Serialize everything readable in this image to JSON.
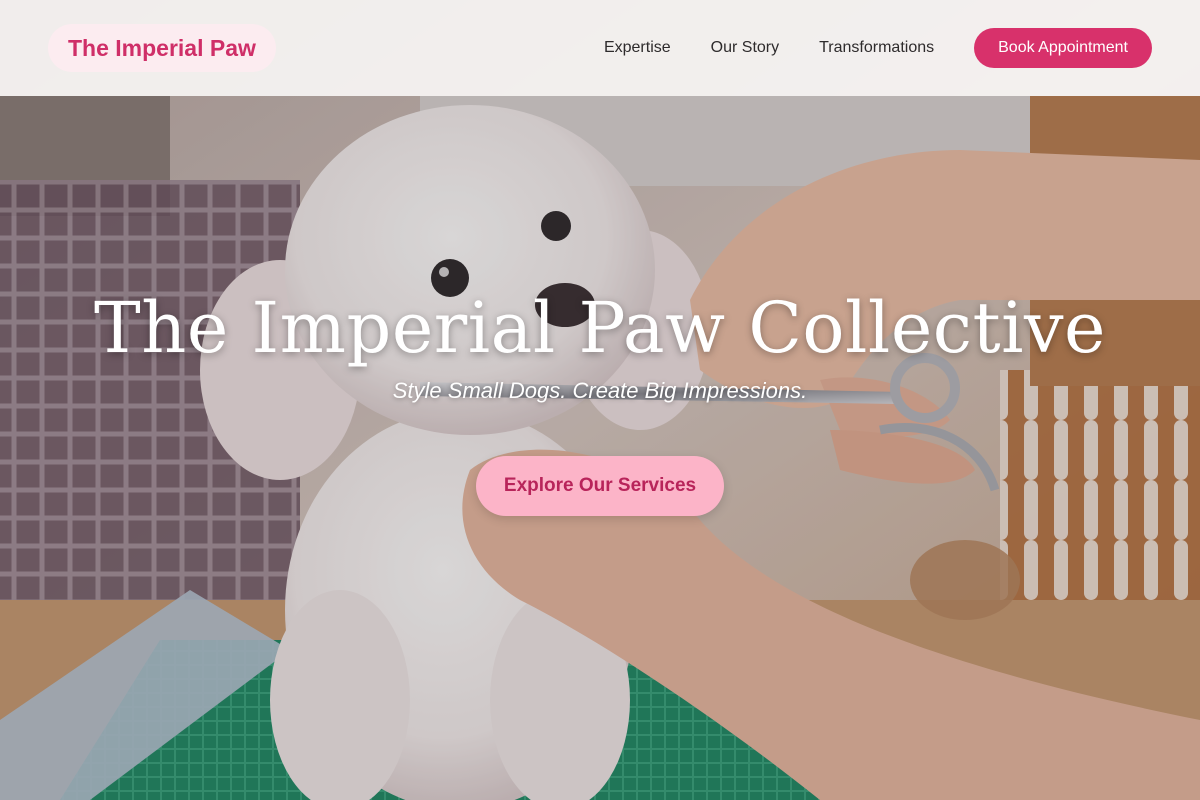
{
  "header": {
    "brand": "The Imperial Paw",
    "nav": [
      {
        "label": "Expertise"
      },
      {
        "label": "Our Story"
      },
      {
        "label": "Transformations"
      }
    ],
    "cta_label": "Book Appointment"
  },
  "hero": {
    "title": "The Imperial Paw Collective",
    "tagline": "Style Small Dogs. Create Big Impressions.",
    "cta_label": "Explore Our Services",
    "image": "white poodle being groomed with scissors on a green grooming table"
  },
  "colors": {
    "brand_pink": "#d8316b",
    "logo_text": "#cf2f68",
    "cta_background": "#fcb4c8",
    "cta_text": "#b8245a",
    "header_background": "#faf7f6"
  }
}
